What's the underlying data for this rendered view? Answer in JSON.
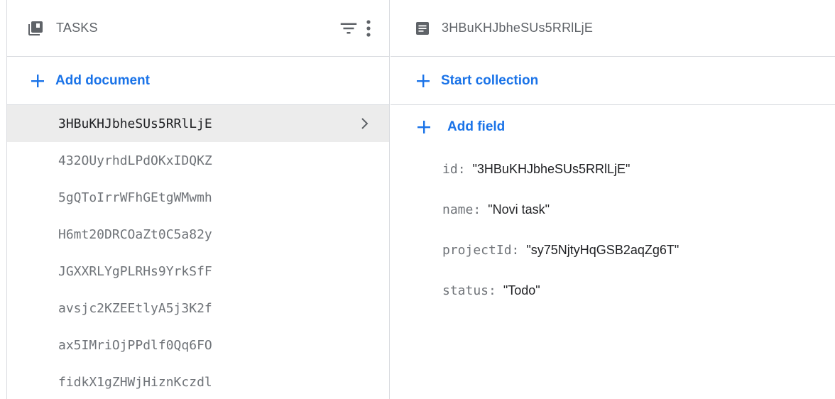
{
  "collection": {
    "title": "TASKS",
    "add_document_label": "Add document",
    "documents": [
      {
        "id": "3HBuKHJbheSUs5RRlLjE",
        "selected": true
      },
      {
        "id": "432OUyrhdLPdOKxIDQKZ"
      },
      {
        "id": "5gQToIrrWFhGEtgWMwmh"
      },
      {
        "id": "H6mt20DRCOaZt0C5a82y"
      },
      {
        "id": "JGXXRLYgPLRHs9YrkSfF"
      },
      {
        "id": "avsjc2KZEEtlyA5j3K2f"
      },
      {
        "id": "ax5IMriOjPPdlf0Qq6FO"
      },
      {
        "id": "fidkX1gZHWjHiznKczdl"
      }
    ]
  },
  "document": {
    "title": "3HBuKHJbheSUs5RRlLjE",
    "start_collection_label": "Start collection",
    "add_field_label": "Add field",
    "fields": [
      {
        "key": "id",
        "value": "\"3HBuKHJbheSUs5RRlLjE\""
      },
      {
        "key": "name",
        "value": "\"Novi task\""
      },
      {
        "key": "projectId",
        "value": "\"sy75NjtyHqGSB2aqZg6T\""
      },
      {
        "key": "status",
        "value": "\"Todo\""
      }
    ]
  },
  "icons": {
    "collection": "collection-icon",
    "filter": "filter-icon",
    "more": "more-vert-icon",
    "document": "document-icon",
    "add": "plus-icon",
    "chevron": "chevron-right-icon"
  },
  "colors": {
    "accent": "#1a73e8",
    "icon": "#5f6368",
    "divider": "#dadce0",
    "selected_bg": "#ececec"
  }
}
